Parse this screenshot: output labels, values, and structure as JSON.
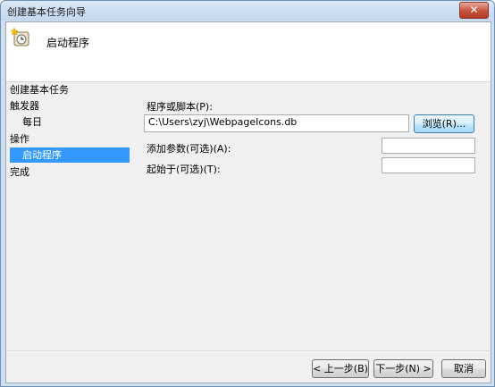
{
  "window": {
    "title": "创建基本任务向导",
    "close_glyph": "✕"
  },
  "header": {
    "title": "启动程序",
    "icon": "clock-star-icon"
  },
  "nav": {
    "items": [
      {
        "label": "创建基本任务",
        "selected": false
      },
      {
        "label": "触发器",
        "selected": false
      },
      {
        "label": "每日",
        "selected": false
      },
      {
        "label": "操作",
        "selected": false
      },
      {
        "label": "启动程序",
        "selected": true
      },
      {
        "label": "完成",
        "selected": false
      }
    ]
  },
  "form": {
    "program_label": "程序或脚本(P):",
    "program_value": "C:\\Users\\zyj\\WebpageIcons.db",
    "browse_label": "浏览(R)...",
    "args_label": "添加参数(可选)(A):",
    "args_value": "",
    "startin_label": "起始于(可选)(T):",
    "startin_value": ""
  },
  "buttons": {
    "back": "< 上一步(B)",
    "next": "下一步(N) >",
    "cancel": "取消"
  },
  "colors": {
    "selection": "#3399ff",
    "close": "#c5523d"
  }
}
